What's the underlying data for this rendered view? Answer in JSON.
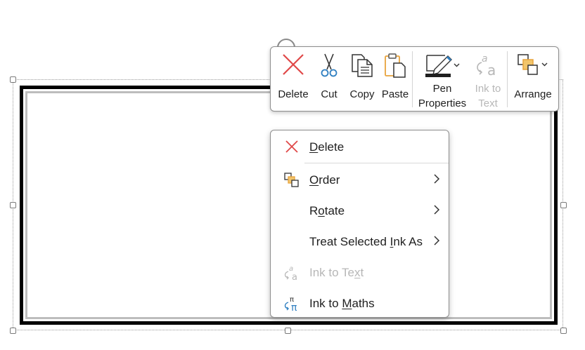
{
  "toolbar": {
    "delete": "Delete",
    "cut": "Cut",
    "copy": "Copy",
    "paste": "Paste",
    "pen_line1": "Pen",
    "pen_line2": "Properties",
    "ink_line1": "Ink to",
    "ink_line2": "Text",
    "arrange": "Arrange"
  },
  "menu": {
    "delete": {
      "pre": "",
      "ul": "D",
      "post": "elete"
    },
    "order": {
      "pre": "",
      "ul": "O",
      "post": "rder"
    },
    "rotate": {
      "pre": "R",
      "ul": "o",
      "post": "tate"
    },
    "treat": {
      "pre": "Treat Selected ",
      "ul": "I",
      "post": "nk As"
    },
    "ink_text": {
      "pre": "Ink to Te",
      "ul": "x",
      "post": "t"
    },
    "ink_maths": {
      "pre": "Ink to ",
      "ul": "M",
      "post": "aths"
    }
  },
  "colors": {
    "delete_red": "#e04848",
    "accent_orange": "#e8a33c",
    "accent_blue": "#2f7fc1",
    "disabled": "#b7b7b7"
  }
}
